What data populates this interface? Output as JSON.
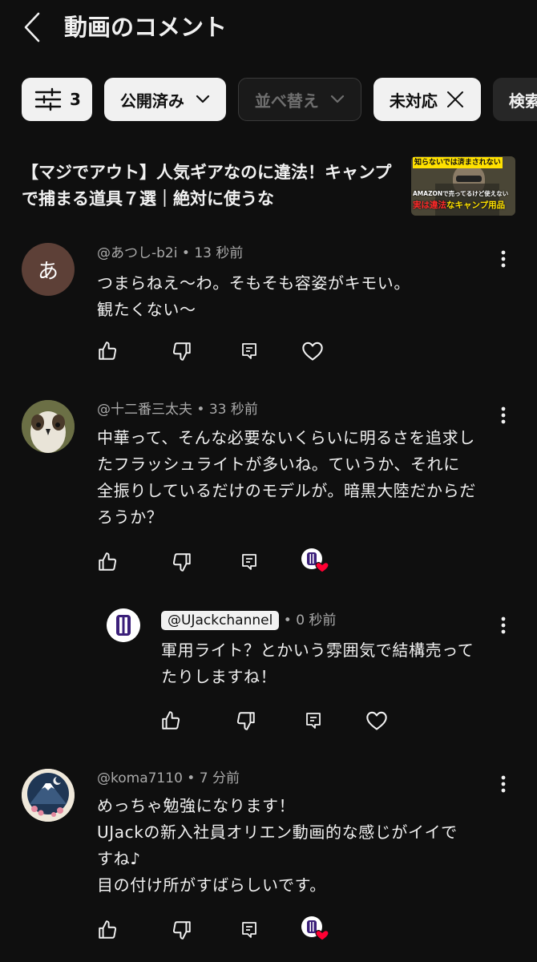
{
  "header": {
    "title": "動画のコメント"
  },
  "filters": {
    "count_chip": "3",
    "status_chip": "公開済み",
    "sort_chip": "並べ替え",
    "unhandled_chip": "未対応",
    "search_chip": "検索"
  },
  "video": {
    "title": "【マジでアウト】人気ギアなのに違法！キャンプで捕まる道具７選｜絶対に使うな",
    "thumb_line1": "知らないでは済まされない",
    "thumb_line2": "AMAZONで売ってるけど使えない",
    "thumb_line3_red": "実は違法",
    "thumb_line3_yellow": "なキャンプ用品"
  },
  "comments": [
    {
      "author": "@あつし-b2i",
      "time": "13 秒前",
      "avatar_letter": "あ",
      "avatar_color": "#5d4037",
      "text": "つまらねえ〜わ。そもそも容姿がキモい。\n観たくない〜"
    },
    {
      "author": "@十二番三太夫",
      "time": "33 秒前",
      "text": "中華って、そんな必要ないくらいに明るさを追求し\nたフラッシュライトが多いね。ていうか、それに\n全振りしているだけのモデルが。暗黒大陸だからだ\nろうか？"
    },
    {
      "author": "@UJackchannel",
      "time": "0 秒前",
      "text": "軍用ライト？とかいう雰囲気で結構売って\nたりしますね！"
    },
    {
      "author": "@koma7110",
      "time": "7 分前",
      "text": "めっちゃ勉強になります！\nUJackの新入社員オリエン動画的な感じがイイで\nすね♪\n目の付け所がすばらしいです。"
    }
  ],
  "colors": {
    "background": "#0f0f0f",
    "heart": "#ff0033",
    "channel_purple": "#3b1f7a"
  }
}
